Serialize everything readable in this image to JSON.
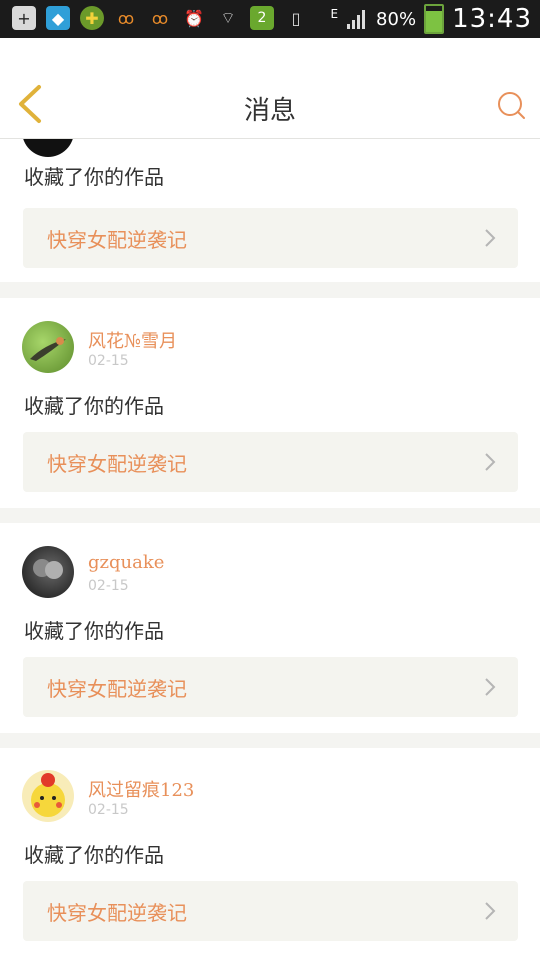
{
  "status_bar": {
    "battery_percent": "80%",
    "battery_level": 0.8,
    "time": "13:43",
    "sim_slot": "2",
    "network": "E"
  },
  "header": {
    "title": "消息"
  },
  "feed": {
    "items": [
      {
        "username": "",
        "date": "",
        "action": "收藏了你的作品",
        "work_title": "快穿女配逆袭记"
      },
      {
        "username": "风花№雪月",
        "date": "02-15",
        "action": "收藏了你的作品",
        "work_title": "快穿女配逆袭记"
      },
      {
        "username": "gzquake",
        "date": "02-15",
        "action": "收藏了你的作品",
        "work_title": "快穿女配逆袭记"
      },
      {
        "username": "风过留痕123",
        "date": "02-15",
        "action": "收藏了你的作品",
        "work_title": "快穿女配逆袭记"
      }
    ]
  },
  "colors": {
    "accent": "#e8905a",
    "back_arrow": "#e0b23a",
    "link_bg": "#f4f4ef",
    "divider": "#f4f4f1"
  }
}
